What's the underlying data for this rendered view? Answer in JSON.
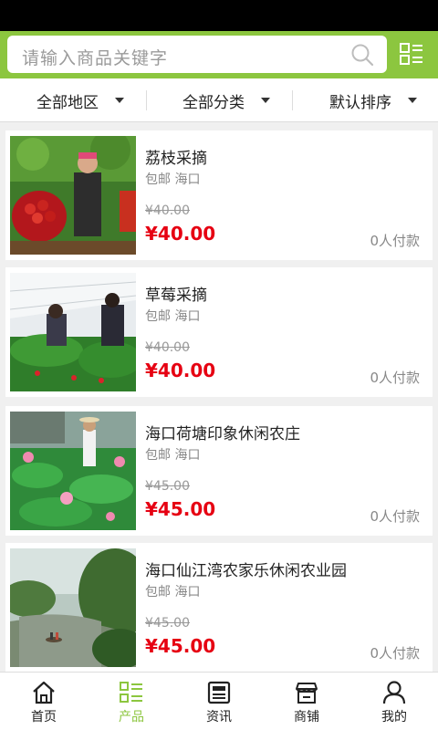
{
  "search": {
    "placeholder": "请输入商品关键字"
  },
  "filters": [
    {
      "label": "全部地区"
    },
    {
      "label": "全部分类"
    },
    {
      "label": "默认排序"
    }
  ],
  "products": [
    {
      "title": "荔枝采摘",
      "shipping": "包邮 海口",
      "old_price": "¥40.00",
      "price": "¥40.00",
      "paid": "0人付款",
      "image": "lychee-picking"
    },
    {
      "title": "草莓采摘",
      "shipping": "包邮 海口",
      "old_price": "¥40.00",
      "price": "¥40.00",
      "paid": "0人付款",
      "image": "strawberry-picking"
    },
    {
      "title": "海口荷塘印象休闲农庄",
      "shipping": "包邮 海口",
      "old_price": "¥45.00",
      "price": "¥45.00",
      "paid": "0人付款",
      "image": "lotus-pond"
    },
    {
      "title": "海口仙江湾农家乐休闲农业园",
      "shipping": "包邮 海口",
      "old_price": "¥45.00",
      "price": "¥45.00",
      "paid": "0人付款",
      "image": "river-boat"
    }
  ],
  "nav": [
    {
      "label": "首页",
      "icon": "home-icon"
    },
    {
      "label": "产品",
      "icon": "list-icon"
    },
    {
      "label": "资讯",
      "icon": "news-icon"
    },
    {
      "label": "商铺",
      "icon": "shop-icon"
    },
    {
      "label": "我的",
      "icon": "user-icon"
    }
  ],
  "colors": {
    "accent": "#8cc63f",
    "price": "#e60012"
  }
}
